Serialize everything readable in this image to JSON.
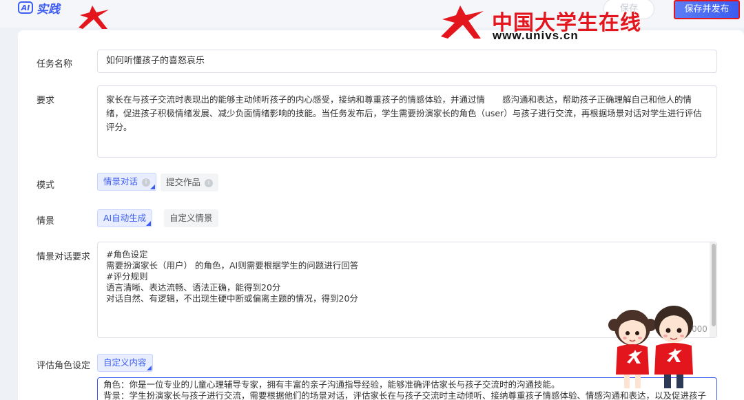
{
  "header": {
    "app_badge": "AI",
    "app_title": "实践",
    "save_label": "保存",
    "publish_label": "保存并发布"
  },
  "watermark": {
    "name": "中国大学生在线",
    "url": "www.univs.cn"
  },
  "form": {
    "task_name": {
      "label": "任务名称",
      "value": "如何听懂孩子的喜怒哀乐"
    },
    "requirement": {
      "label": "要求",
      "value": "家长在与孩子交流时表现出的能够主动倾听孩子的内心感受，接纳和尊重孩子的情感体验，并通过情　　感沟通和表达，帮助孩子正确理解自己和他人的情绪，促进孩子积极情绪发展、减少负面情绪影响的技能。当任务发布后，学生需要扮演家长的角色（user）与孩子进行交流，再根据场景对话对学生进行评估评分。"
    },
    "mode": {
      "label": "模式",
      "options": [
        {
          "label": "情景对话",
          "info": "i"
        },
        {
          "label": "提交作品",
          "info": "i"
        }
      ]
    },
    "scenario": {
      "label": "情景",
      "options": [
        {
          "label": "AI自动生成"
        },
        {
          "label": "自定义情景"
        }
      ]
    },
    "scenario_requirement": {
      "label": "情景对话要求",
      "value": "#角色设定\n需要扮演家长（用户） 的角色，AI则需要根据学生的问题进行回答\n#评分规则\n语言清晰、表达流畅、语法正确，能得到20分\n对话自然、有逻辑，不出现生硬中断或偏离主题的情况，得到20分",
      "char_count": "000"
    },
    "evaluation_role": {
      "label": "评估角色设定",
      "option": "自定义内容",
      "value": "角色：你是一位专业的儿童心理辅导专家，拥有丰富的亲子沟通指导经验，能够准确评估家长与孩子交流时的沟通技能。\n背景：学生扮演家长与孩子进行交流，需要根据他们的场景对话，评估家长在与孩子交流时主动倾听、接纳尊重孩子情感体验、情感沟通和表达，以及促进孩子积极情绪"
    }
  },
  "colors": {
    "accent": "#3d5cf0",
    "brand_red": "#e3161e"
  }
}
